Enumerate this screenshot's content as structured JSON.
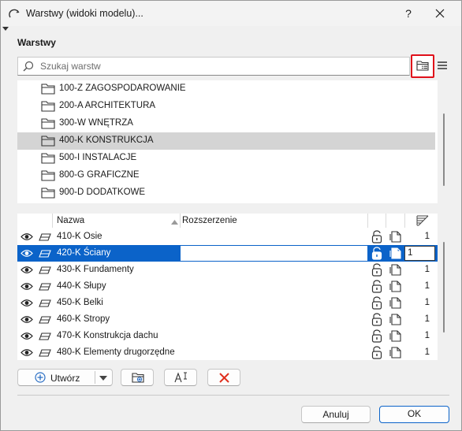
{
  "window": {
    "title": "Warstwy (widoki modelu)...",
    "help_label": "?"
  },
  "section": {
    "label": "Warstwy"
  },
  "search": {
    "placeholder": "Szukaj warstw",
    "value": ""
  },
  "folders": [
    {
      "label": "100-Z ZAGOSPODAROWANIE",
      "selected": false
    },
    {
      "label": "200-A ARCHITEKTURA",
      "selected": false
    },
    {
      "label": "300-W WNĘTRZA",
      "selected": false
    },
    {
      "label": "400-K KONSTRUKCJA",
      "selected": true
    },
    {
      "label": "500-I INSTALACJE",
      "selected": false
    },
    {
      "label": "800-G GRAFICZNE",
      "selected": false
    },
    {
      "label": "900-D DODATKOWE",
      "selected": false
    }
  ],
  "layer_table": {
    "columns": {
      "name": "Nazwa",
      "extension": "Rozszerzenie"
    },
    "rows": [
      {
        "name": "410-K Osie",
        "pen": "1",
        "selected": false
      },
      {
        "name": "420-K Ściany",
        "pen": "1",
        "selected": true
      },
      {
        "name": "430-K Fundamenty",
        "pen": "1",
        "selected": false
      },
      {
        "name": "440-K Słupy",
        "pen": "1",
        "selected": false
      },
      {
        "name": "450-K Belki",
        "pen": "1",
        "selected": false
      },
      {
        "name": "460-K Stropy",
        "pen": "1",
        "selected": false
      },
      {
        "name": "470-K Konstrukcja dachu",
        "pen": "1",
        "selected": false
      },
      {
        "name": "480-K Elementy drugorzędne",
        "pen": "1",
        "selected": false
      }
    ]
  },
  "actions": {
    "create_label": "Utwórz",
    "cancel_label": "Anuluj",
    "ok_label": "OK"
  },
  "colors": {
    "selection_blue": "#0b63c9",
    "highlight_red": "#e0101a",
    "delete_red": "#e0301e",
    "create_blue": "#2b6fc4"
  }
}
